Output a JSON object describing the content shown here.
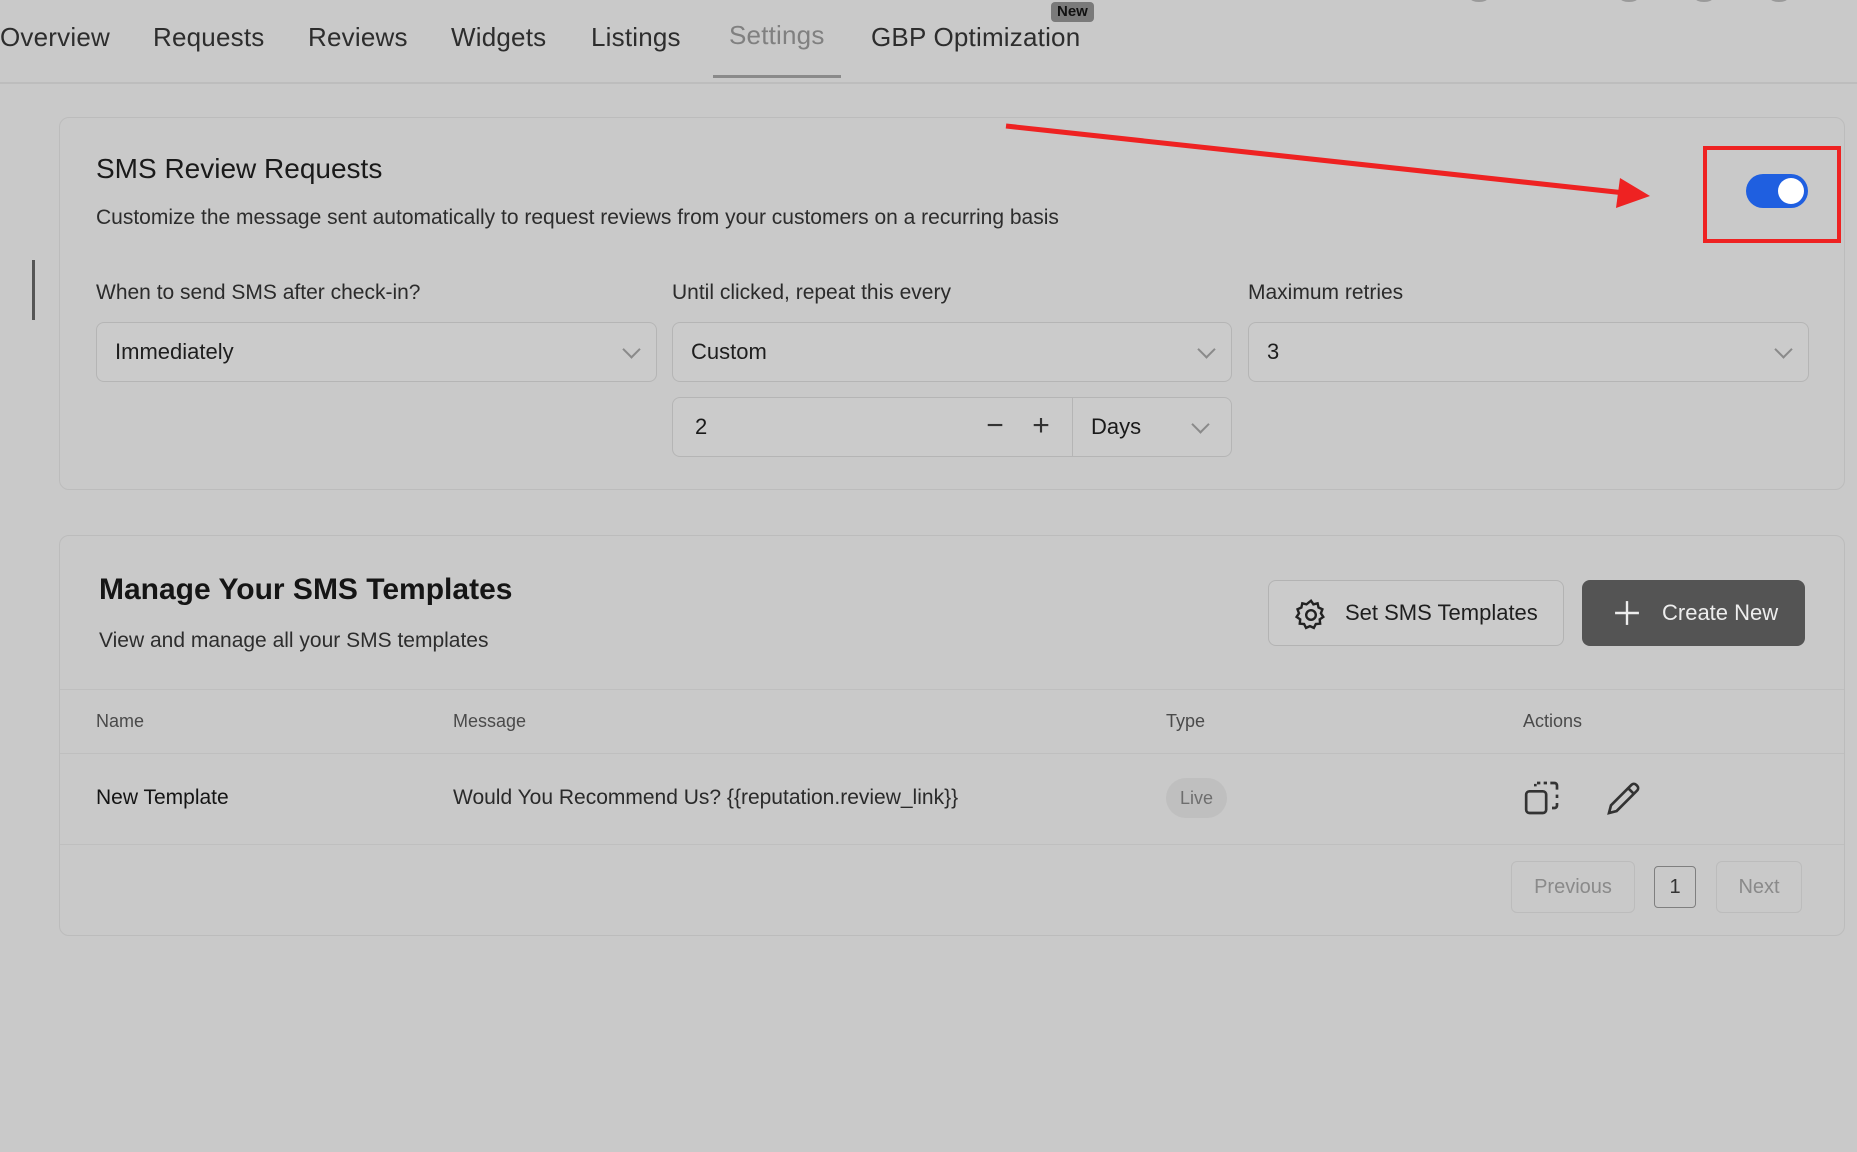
{
  "nav": {
    "tabs": [
      {
        "label": "Overview"
      },
      {
        "label": "Requests"
      },
      {
        "label": "Reviews"
      },
      {
        "label": "Widgets"
      },
      {
        "label": "Listings"
      },
      {
        "label": "Settings",
        "active": true
      },
      {
        "label": "GBP Optimization",
        "badge": "New"
      }
    ]
  },
  "sms": {
    "title": "SMS Review Requests",
    "description": "Customize the message sent automatically to request reviews from your customers on a recurring basis",
    "toggle_on": true,
    "fields": {
      "send_after": {
        "label": "When to send SMS after check-in?",
        "value": "Immediately"
      },
      "repeat_every": {
        "label": "Until clicked, repeat this every",
        "value": "Custom"
      },
      "max_retries": {
        "label": "Maximum retries",
        "value": "3"
      }
    },
    "custom_interval": {
      "value": "2",
      "minus": "−",
      "plus": "+",
      "unit": "Days"
    }
  },
  "templates": {
    "title": "Manage Your SMS Templates",
    "description": "View and manage all your SMS templates",
    "set_button": "Set SMS Templates",
    "create_button": "Create New",
    "columns": [
      "Name",
      "Message",
      "Type",
      "Actions"
    ],
    "rows": [
      {
        "name": "New Template",
        "message": "Would You Recommend Us? {{reputation.review_link}}",
        "type": "Live"
      }
    ],
    "pagination": {
      "previous": "Previous",
      "current": "1",
      "next": "Next"
    }
  },
  "colors": {
    "toggle": "#1f5fe0",
    "highlight": "#ee2222",
    "primary_button": "#545454"
  },
  "icons": {
    "set_button": "gear-icon",
    "create_button": "plus-icon",
    "copy_action": "copy-icon",
    "edit_action": "pencil-icon"
  }
}
